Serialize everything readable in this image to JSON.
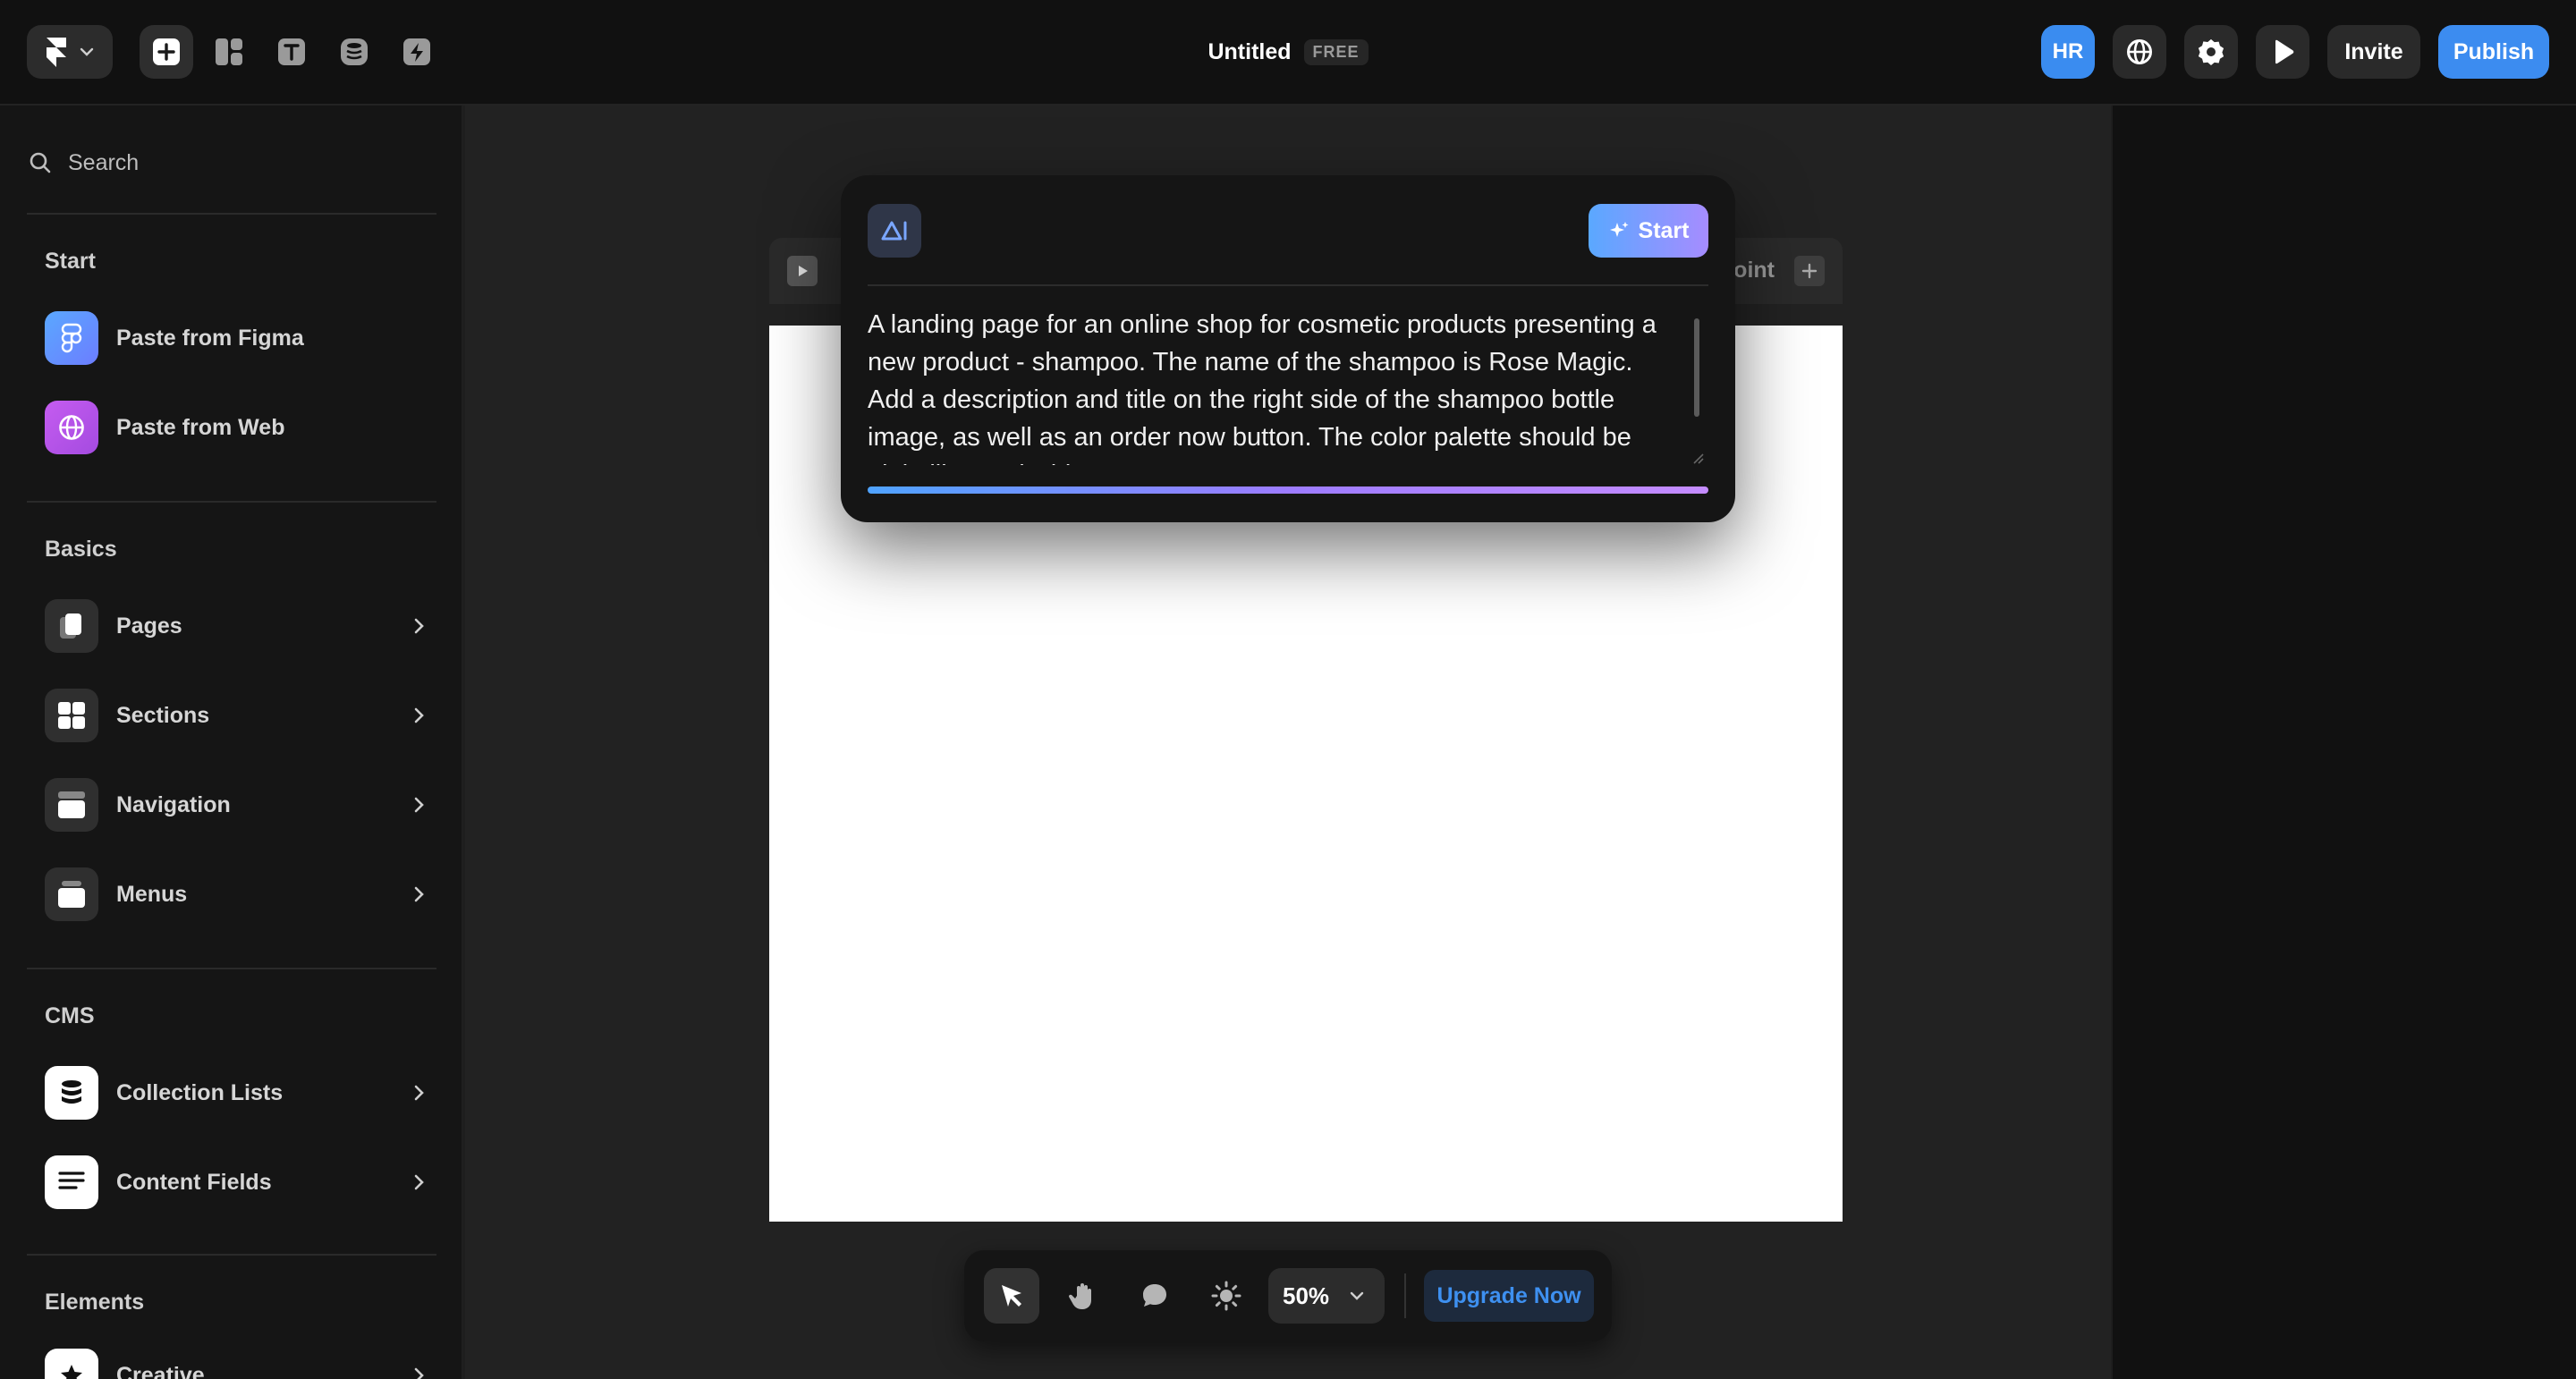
{
  "topbar": {
    "title": "Untitled",
    "plan_badge": "FREE",
    "avatar_initials": "HR",
    "invite_label": "Invite",
    "publish_label": "Publish"
  },
  "sidebar": {
    "search_placeholder": "Search",
    "sections": {
      "start": "Start",
      "basics": "Basics",
      "cms": "CMS",
      "elements": "Elements"
    },
    "start_items": [
      {
        "label": "Paste from Figma",
        "icon": "figma-icon"
      },
      {
        "label": "Paste from Web",
        "icon": "globe-icon"
      }
    ],
    "basics_items": [
      {
        "label": "Pages",
        "icon": "page-icon"
      },
      {
        "label": "Sections",
        "icon": "sections-icon"
      },
      {
        "label": "Navigation",
        "icon": "navigation-icon"
      },
      {
        "label": "Menus",
        "icon": "menus-icon"
      }
    ],
    "cms_items": [
      {
        "label": "Collection Lists",
        "icon": "database-icon"
      },
      {
        "label": "Content Fields",
        "icon": "lines-icon"
      }
    ],
    "elements_items": [
      {
        "label": "Creative",
        "icon": "star-icon"
      }
    ]
  },
  "canvas": {
    "breakpoint_label": "oint"
  },
  "ai_modal": {
    "start_label": "Start",
    "prompt_text": "A landing page for an online shop for cosmetic products presenting a new product - shampoo. The name of the shampoo is Rose Magic. Add a description and title on the right side of the shampoo bottle image, as well as an order now button. The color palette should be pink, lilac and white."
  },
  "bottom_toolbar": {
    "zoom": "50%",
    "upgrade_label": "Upgrade Now"
  },
  "colors": {
    "accent": "#3c8cf0",
    "background": "#1e1e1e",
    "panel": "#151515",
    "ai_gradient_start": "#5aa8ff",
    "ai_gradient_end": "#a68cff"
  }
}
